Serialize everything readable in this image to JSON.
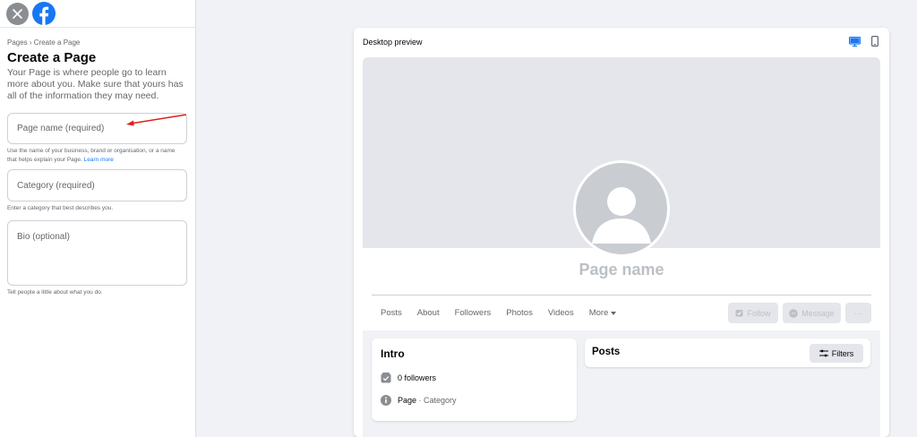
{
  "sidebar": {
    "breadcrumb": "Pages › Create a Page",
    "heading": "Create a Page",
    "intro": "Your Page is where people go to learn more about you. Make sure that yours has all of the information they may need.",
    "name_placeholder": "Page name (required)",
    "name_help": "Use the name of your business, brand or organisation, or a name that helps explain your Page.",
    "learn_more": "Learn more",
    "category_placeholder": "Category (required)",
    "category_help": "Enter a category that best describes you.",
    "bio_placeholder": "Bio (optional)",
    "bio_help": "Tell people a little about what you do."
  },
  "preview": {
    "title": "Desktop preview",
    "page_name": "Page name",
    "tabs": [
      "Posts",
      "About",
      "Followers",
      "Photos",
      "Videos",
      "More"
    ],
    "follow_label": "Follow",
    "message_label": "Message",
    "more_label": "···",
    "intro": {
      "title": "Intro",
      "followers": "0 followers",
      "page_label": "Page",
      "category_label": " · Category"
    },
    "posts": {
      "title": "Posts",
      "filters_label": "Filters"
    }
  },
  "colors": {
    "brand": "#1877f2",
    "annotation_arrow": "#e0201b"
  }
}
